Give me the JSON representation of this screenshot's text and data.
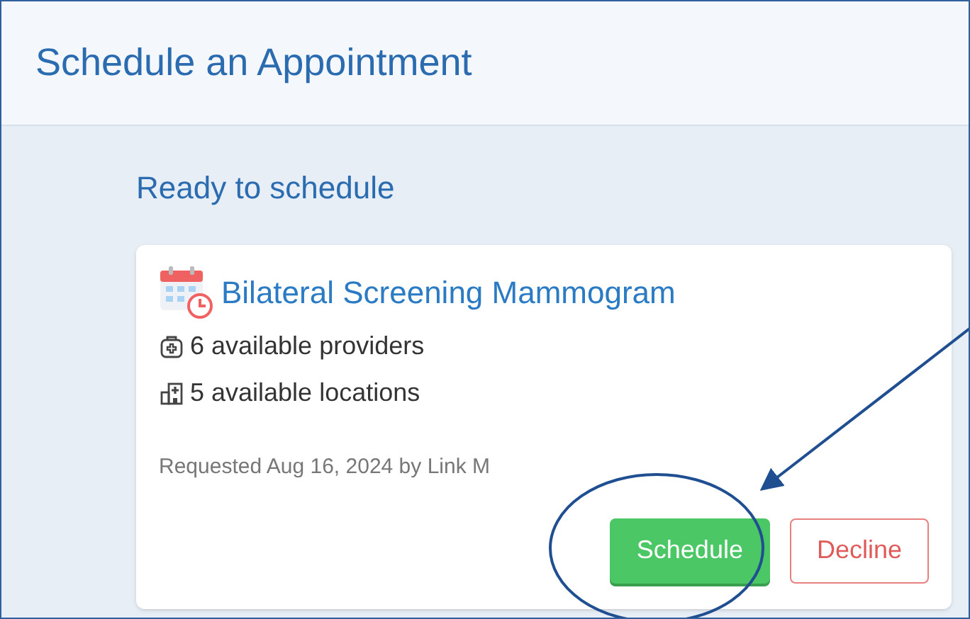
{
  "page": {
    "title": "Schedule an Appointment"
  },
  "section": {
    "title": "Ready to schedule"
  },
  "card": {
    "title": "Bilateral Screening Mammogram",
    "details": [
      {
        "kind": "providers",
        "text": "6 available providers"
      },
      {
        "kind": "locations",
        "text": "5 available locations"
      }
    ],
    "requested": "Requested Aug 16, 2024 by Link M",
    "buttons": [
      {
        "kind": "primary",
        "label": "Schedule"
      },
      {
        "kind": "danger",
        "label": "Decline"
      }
    ]
  }
}
